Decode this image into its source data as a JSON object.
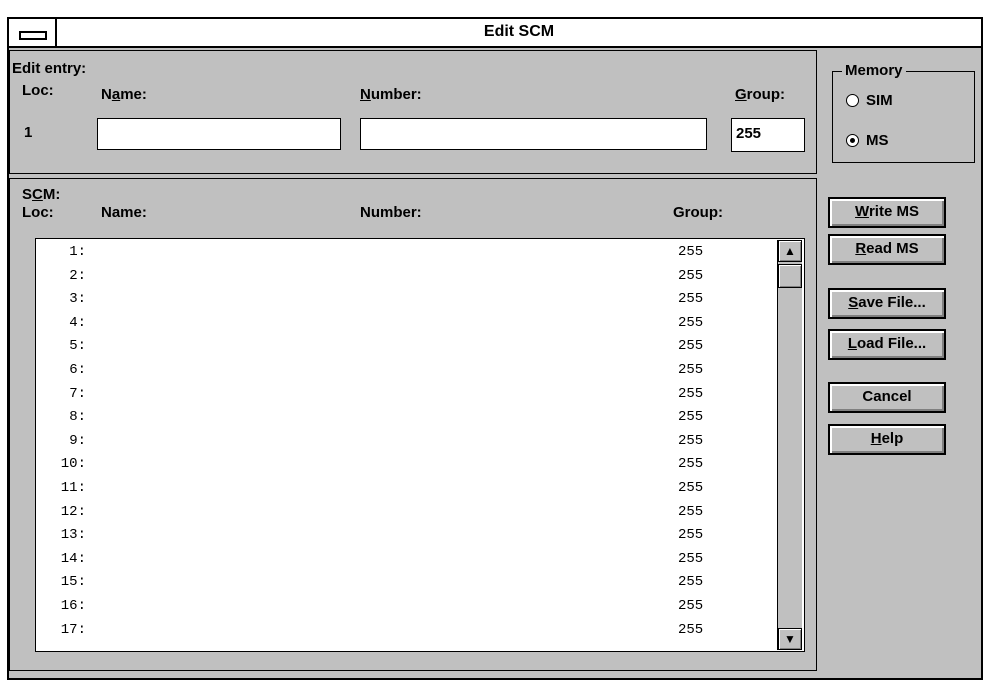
{
  "window": {
    "title": "Edit SCM"
  },
  "edit": {
    "label": "Edit entry:",
    "loc_label": "Loc:",
    "name_label_pre": "N",
    "name_label_u": "a",
    "name_label_post": "me:",
    "number_label_u": "N",
    "number_label_post": "umber:",
    "group_label_u": "G",
    "group_label_post": "roup:",
    "loc_value": "1",
    "name_value": "",
    "number_value": "",
    "group_value": "255"
  },
  "memory": {
    "label": "Memory",
    "options": [
      {
        "label": "SIM",
        "selected": false
      },
      {
        "label": "MS",
        "selected": true
      }
    ]
  },
  "scm": {
    "label_pre": "S",
    "label_u": "C",
    "label_post": "M:",
    "col_loc": "Loc:",
    "col_name": "Name:",
    "col_number": "Number:",
    "col_group": "Group:",
    "rows": [
      {
        "loc": "1:",
        "group": "255"
      },
      {
        "loc": "2:",
        "group": "255"
      },
      {
        "loc": "3:",
        "group": "255"
      },
      {
        "loc": "4:",
        "group": "255"
      },
      {
        "loc": "5:",
        "group": "255"
      },
      {
        "loc": "6:",
        "group": "255"
      },
      {
        "loc": "7:",
        "group": "255"
      },
      {
        "loc": "8:",
        "group": "255"
      },
      {
        "loc": "9:",
        "group": "255"
      },
      {
        "loc": "10:",
        "group": "255"
      },
      {
        "loc": "11:",
        "group": "255"
      },
      {
        "loc": "12:",
        "group": "255"
      },
      {
        "loc": "13:",
        "group": "255"
      },
      {
        "loc": "14:",
        "group": "255"
      },
      {
        "loc": "15:",
        "group": "255"
      },
      {
        "loc": "16:",
        "group": "255"
      },
      {
        "loc": "17:",
        "group": "255"
      }
    ]
  },
  "buttons": {
    "write_u": "W",
    "write_rest": "rite MS",
    "read_u": "R",
    "read_rest": "ead MS",
    "save_u": "S",
    "save_rest": "ave File...",
    "load_u": "L",
    "load_rest": "oad File...",
    "cancel": "Cancel",
    "help_u": "H",
    "help_rest": "elp"
  },
  "icons": {
    "scroll_up": "up-arrow-icon",
    "scroll_down": "down-arrow-icon",
    "system_menu": "system-menu-icon"
  }
}
